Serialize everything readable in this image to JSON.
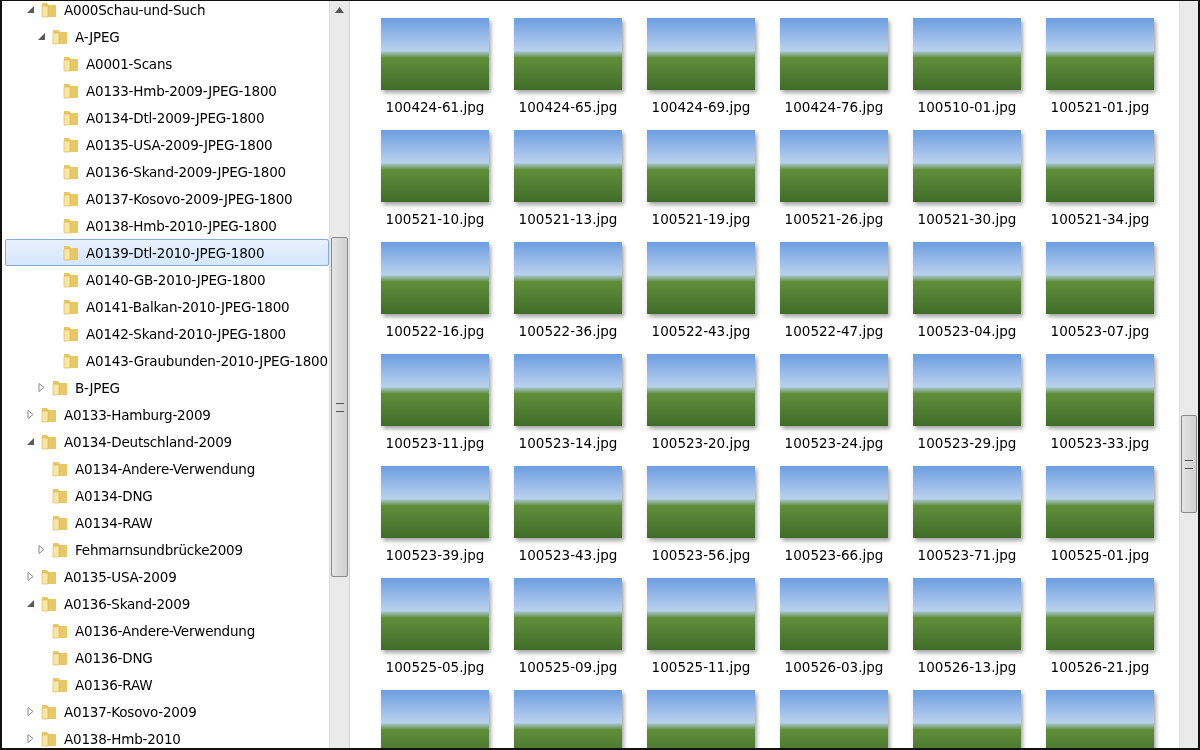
{
  "folder_tree": [
    {
      "label": "A000Schau-und-Such",
      "expanded": true,
      "selected": false,
      "children": [
        {
          "label": "A-JPEG",
          "expanded": true,
          "selected": false,
          "children": [
            {
              "label": "A0001-Scans",
              "selected": false
            },
            {
              "label": "A0133-Hmb-2009-JPEG-1800",
              "selected": false
            },
            {
              "label": "A0134-Dtl-2009-JPEG-1800",
              "selected": false
            },
            {
              "label": "A0135-USA-2009-JPEG-1800",
              "selected": false
            },
            {
              "label": "A0136-Skand-2009-JPEG-1800",
              "selected": false
            },
            {
              "label": "A0137-Kosovo-2009-JPEG-1800",
              "selected": false
            },
            {
              "label": "A0138-Hmb-2010-JPEG-1800",
              "selected": false
            },
            {
              "label": "A0139-Dtl-2010-JPEG-1800",
              "selected": true
            },
            {
              "label": "A0140-GB-2010-JPEG-1800",
              "selected": false
            },
            {
              "label": "A0141-Balkan-2010-JPEG-1800",
              "selected": false
            },
            {
              "label": "A0142-Skand-2010-JPEG-1800",
              "selected": false
            },
            {
              "label": "A0143-Graubunden-2010-JPEG-1800",
              "selected": false
            }
          ]
        },
        {
          "label": "B-JPEG",
          "expanded": false,
          "selected": false
        }
      ]
    },
    {
      "label": "A0133-Hamburg-2009",
      "expanded": false,
      "selected": false
    },
    {
      "label": "A0134-Deutschland-2009",
      "expanded": true,
      "selected": false,
      "children": [
        {
          "label": "A0134-Andere-Verwendung",
          "selected": false
        },
        {
          "label": "A0134-DNG",
          "selected": false
        },
        {
          "label": "A0134-RAW",
          "selected": false
        },
        {
          "label": "Fehmarnsundbrücke2009",
          "expanded": false,
          "selected": false
        }
      ]
    },
    {
      "label": "A0135-USA-2009",
      "expanded": false,
      "selected": false
    },
    {
      "label": "A0136-Skand-2009",
      "expanded": true,
      "selected": false,
      "children": [
        {
          "label": "A0136-Andere-Verwendung",
          "selected": false
        },
        {
          "label": "A0136-DNG",
          "selected": false
        },
        {
          "label": "A0136-RAW",
          "selected": false
        }
      ]
    },
    {
      "label": "A0137-Kosovo-2009",
      "expanded": false,
      "selected": false
    },
    {
      "label": "A0138-Hmb-2010",
      "expanded": false,
      "selected": false
    }
  ],
  "photos": [
    {
      "kind": "labeled",
      "label": "100424-61.jpg"
    },
    {
      "kind": "labeled",
      "label": "100424-65.jpg"
    },
    {
      "kind": "labeled",
      "label": "100424-69.jpg"
    },
    {
      "kind": "labeled",
      "label": "100424-76.jpg"
    },
    {
      "kind": "labeled",
      "label": "100510-01.jpg"
    },
    {
      "kind": "labeled",
      "label": "100521-01.jpg"
    },
    {
      "kind": "labeled",
      "label": "100521-10.jpg"
    },
    {
      "kind": "labeled",
      "label": "100521-13.jpg"
    },
    {
      "kind": "labeled",
      "label": "100521-19.jpg"
    },
    {
      "kind": "labeled",
      "label": "100521-26.jpg"
    },
    {
      "kind": "labeled",
      "label": "100521-30.jpg"
    },
    {
      "kind": "labeled",
      "label": "100521-34.jpg"
    },
    {
      "kind": "labeled",
      "label": "100522-16.jpg"
    },
    {
      "kind": "labeled",
      "label": "100522-36.jpg"
    },
    {
      "kind": "labeled",
      "label": "100522-43.jpg"
    },
    {
      "kind": "labeled",
      "label": "100522-47.jpg"
    },
    {
      "kind": "labeled",
      "label": "100523-04.jpg"
    },
    {
      "kind": "labeled",
      "label": "100523-07.jpg"
    },
    {
      "kind": "labeled",
      "label": "100523-11.jpg"
    },
    {
      "kind": "labeled",
      "label": "100523-14.jpg"
    },
    {
      "kind": "labeled",
      "label": "100523-20.jpg"
    },
    {
      "kind": "labeled",
      "label": "100523-24.jpg"
    },
    {
      "kind": "labeled",
      "label": "100523-29.jpg"
    },
    {
      "kind": "labeled",
      "label": "100523-33.jpg"
    },
    {
      "kind": "labeled",
      "label": "100523-39.jpg"
    },
    {
      "kind": "labeled",
      "label": "100523-43.jpg"
    },
    {
      "kind": "labeled",
      "label": "100523-56.jpg"
    },
    {
      "kind": "labeled",
      "label": "100523-66.jpg"
    },
    {
      "kind": "labeled",
      "label": "100523-71.jpg"
    },
    {
      "kind": "labeled",
      "label": "100525-01.jpg"
    },
    {
      "kind": "labeled",
      "label": "100525-05.jpg"
    },
    {
      "kind": "labeled",
      "label": "100525-09.jpg"
    },
    {
      "kind": "labeled",
      "label": "100525-11.jpg"
    },
    {
      "kind": "labeled",
      "label": "100526-03.jpg"
    },
    {
      "kind": "labeled",
      "label": "100526-13.jpg"
    },
    {
      "kind": "labeled",
      "label": "100526-21.jpg"
    },
    {
      "kind": "unlabeled"
    },
    {
      "kind": "unlabeled"
    },
    {
      "kind": "unlabeled"
    },
    {
      "kind": "unlabeled"
    },
    {
      "kind": "unlabeled"
    },
    {
      "kind": "unlabeled"
    }
  ]
}
